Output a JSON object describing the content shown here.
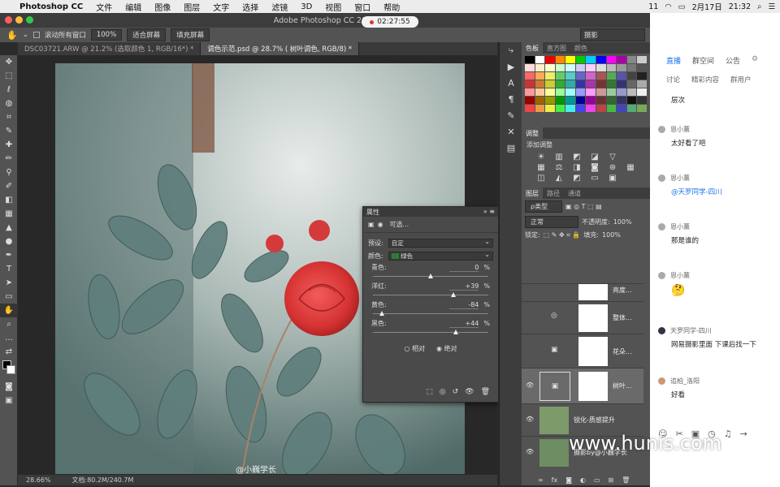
{
  "menubar": {
    "app": "Photoshop CC",
    "items": [
      "文件",
      "编辑",
      "图像",
      "图层",
      "文字",
      "选择",
      "滤镜",
      "3D",
      "视图",
      "窗口",
      "帮助"
    ],
    "date": "2月17日",
    "time": "21:32",
    "battery_badge": "11"
  },
  "titlebar": {
    "title": "Adobe Photoshop CC 2018",
    "recording_time": "02:27:55"
  },
  "options": {
    "scroll_all": "滚动所有窗口",
    "zoom": "100%",
    "fit": "适合屏幕",
    "fill": "填充屏幕",
    "workspace": "摄影"
  },
  "tabs": [
    {
      "label": "DSC03721.ARW @ 21.2% (选取颜色 1, RGB/16*) *"
    },
    {
      "label": "调色示范.psd @ 28.7% ( 树叶调色, RGB/8) *"
    }
  ],
  "status": {
    "zoom": "28.66%",
    "doc": "文档:80.2M/240.7M"
  },
  "canvas": {
    "watermark": "@小巍学长"
  },
  "properties": {
    "title": "属性",
    "subtitle": "可选...",
    "preset_label": "预设:",
    "preset_value": "自定",
    "colors_label": "颜色:",
    "colors_value": "绿色",
    "sliders": [
      {
        "label": "青色:",
        "value": "0",
        "pct": 0.5
      },
      {
        "label": "洋红:",
        "value": "+39",
        "pct": 0.695
      },
      {
        "label": "黄色:",
        "value": "-84",
        "pct": 0.08
      },
      {
        "label": "黑色:",
        "value": "+44",
        "pct": 0.72
      }
    ],
    "unit": "%",
    "relative": "相对",
    "absolute": "绝对"
  },
  "panels": {
    "swatch_tabs": [
      "色板",
      "直方图",
      "颜色"
    ],
    "adjust_title": "调整",
    "adjust_sub": "添加调整",
    "layer_tabs": [
      "图层",
      "路径",
      "通道"
    ],
    "filter_label": "ρ类型",
    "blend_mode": "正常",
    "opacity_label": "不透明度:",
    "opacity_value": "100%",
    "lock_label": "锁定:",
    "fill_label": "填充:",
    "fill_value": "100%",
    "layers": [
      {
        "name": "亮度..."
      },
      {
        "name": "整体..."
      },
      {
        "name": "花朵..."
      },
      {
        "name": "树叶..."
      },
      {
        "name": "锐化-质感提升"
      },
      {
        "name": "摄影by@小巍学长"
      }
    ]
  },
  "chat": {
    "tabs": [
      "直播",
      "群空间",
      "公告"
    ],
    "subtabs": [
      "讨论",
      "精彩内容",
      "群用户"
    ],
    "messages": [
      {
        "user": "",
        "text": "层次"
      },
      {
        "user": "恩小薰",
        "text": "太好看了吧"
      },
      {
        "user": "恩小薰",
        "text": "@天罗同学-四川"
      },
      {
        "user": "恩小薰",
        "text": "那是谁的"
      },
      {
        "user": "恩小薰",
        "text": "🤔"
      },
      {
        "user": "天罗同学-四川",
        "text": "网易摄影里面 下课后找一下"
      },
      {
        "user": "追柏_洛阳",
        "text": "好看"
      }
    ]
  },
  "site_watermark": "www.hunis.com",
  "colors": {
    "accent": "#1a73e8",
    "ps_panel": "#535353",
    "rose": "#e03a3a"
  }
}
